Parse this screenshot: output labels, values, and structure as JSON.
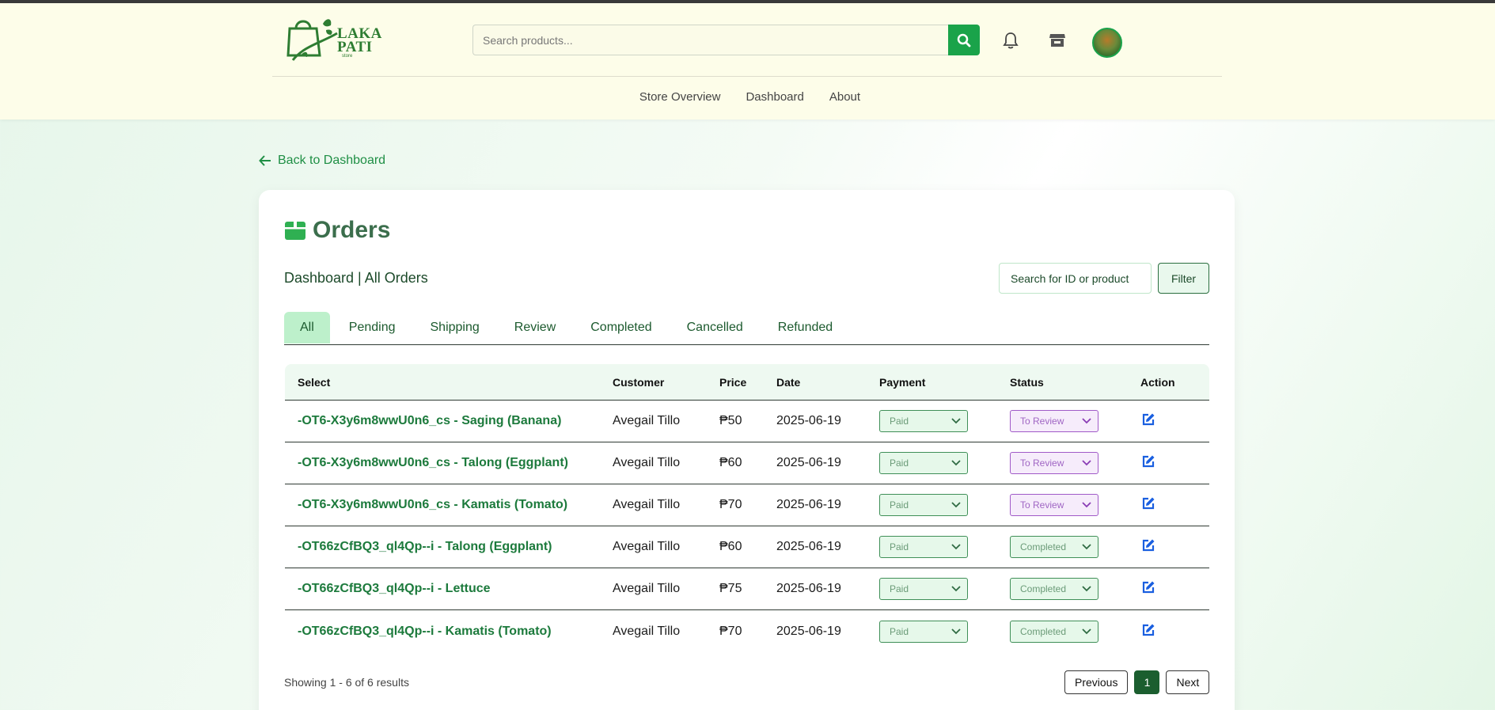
{
  "header": {
    "logo_text": "LAKA PATI",
    "logo_sub": "store",
    "search_placeholder": "Search products...",
    "nav": [
      "Store Overview",
      "Dashboard",
      "About"
    ]
  },
  "back_link": "Back to Dashboard",
  "page": {
    "title": "Orders",
    "breadcrumb": "Dashboard | All Orders",
    "order_search_placeholder": "Search for ID or product",
    "filter_label": "Filter",
    "tabs": [
      "All",
      "Pending",
      "Shipping",
      "Review",
      "Completed",
      "Cancelled",
      "Refunded"
    ],
    "active_tab": "All"
  },
  "table": {
    "headers": [
      "Select",
      "Customer",
      "Price",
      "Date",
      "Payment",
      "Status",
      "Action"
    ],
    "rows": [
      {
        "product": "-OT6-X3y6m8wwU0n6_cs - Saging (Banana)",
        "customer": "Avegail Tillo",
        "price": "₱50",
        "date": "2025-06-19",
        "payment": "Paid",
        "status": "To Review"
      },
      {
        "product": "-OT6-X3y6m8wwU0n6_cs - Talong (Eggplant)",
        "customer": "Avegail Tillo",
        "price": "₱60",
        "date": "2025-06-19",
        "payment": "Paid",
        "status": "To Review"
      },
      {
        "product": "-OT6-X3y6m8wwU0n6_cs - Kamatis (Tomato)",
        "customer": "Avegail Tillo",
        "price": "₱70",
        "date": "2025-06-19",
        "payment": "Paid",
        "status": "To Review"
      },
      {
        "product": "-OT66zCfBQ3_ql4Qp--i - Talong (Eggplant)",
        "customer": "Avegail Tillo",
        "price": "₱60",
        "date": "2025-06-19",
        "payment": "Paid",
        "status": "Completed"
      },
      {
        "product": "-OT66zCfBQ3_ql4Qp--i - Lettuce",
        "customer": "Avegail Tillo",
        "price": "₱75",
        "date": "2025-06-19",
        "payment": "Paid",
        "status": "Completed"
      },
      {
        "product": "-OT66zCfBQ3_ql4Qp--i - Kamatis (Tomato)",
        "customer": "Avegail Tillo",
        "price": "₱70",
        "date": "2025-06-19",
        "payment": "Paid",
        "status": "Completed"
      }
    ]
  },
  "pagination": {
    "showing": "Showing 1 - 6 of 6 results",
    "previous": "Previous",
    "current": "1",
    "next": "Next"
  },
  "colors": {
    "accent": "#1aa34a",
    "header_bg": "#fdfde9",
    "review_purple": "#a05ac8",
    "edit_blue": "#1a5fe0"
  }
}
